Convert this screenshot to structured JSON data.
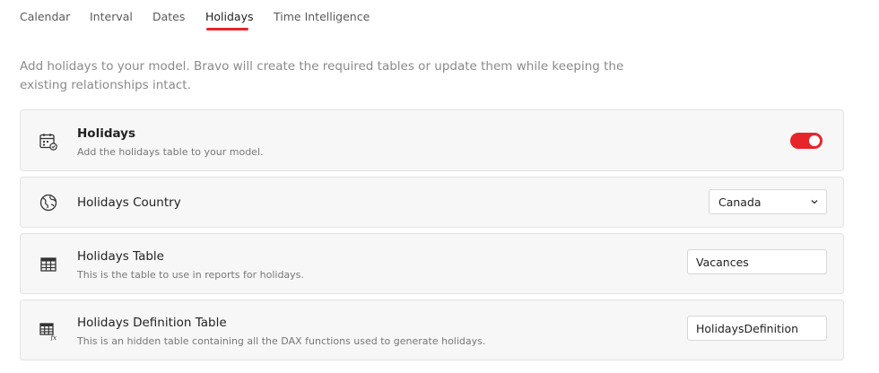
{
  "tabs": [
    {
      "label": "Calendar",
      "active": false
    },
    {
      "label": "Interval",
      "active": false
    },
    {
      "label": "Dates",
      "active": false
    },
    {
      "label": "Holidays",
      "active": true
    },
    {
      "label": "Time Intelligence",
      "active": false
    }
  ],
  "intro": "Add holidays to your model. Bravo will create the required tables or update them while keeping the existing relationships intact.",
  "cards": {
    "holidays": {
      "title": "Holidays",
      "description": "Add the holidays table to your model.",
      "enabled": true,
      "icon": "calendar-holidays-icon"
    },
    "country": {
      "title": "Holidays Country",
      "selected": "Canada",
      "icon": "globe-icon"
    },
    "table": {
      "title": "Holidays Table",
      "description": "This is the table to use in reports for holidays.",
      "value": "Vacances",
      "icon": "table-icon"
    },
    "definition": {
      "title": "Holidays Definition Table",
      "description": "This is an hidden table containing all the DAX functions used to generate holidays.",
      "value": "HolidaysDefinition",
      "icon": "table-function-icon"
    }
  },
  "colors": {
    "accent": "#e8242b",
    "card_bg": "#f7f7f7",
    "muted_text": "#8a8a8a"
  }
}
